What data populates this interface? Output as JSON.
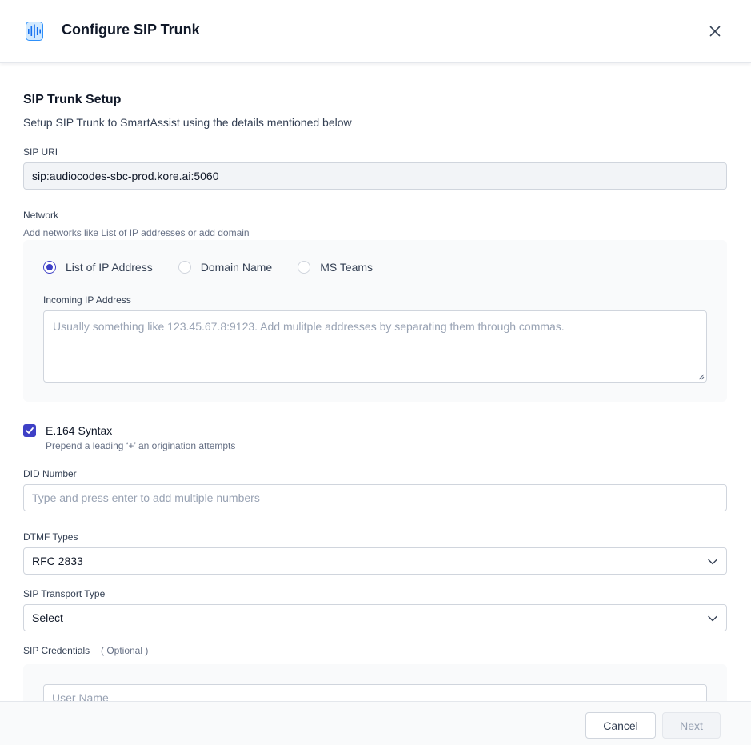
{
  "header": {
    "title": "Configure SIP Trunk",
    "icon": "sound-wave-icon"
  },
  "form": {
    "section_title": "SIP Trunk Setup",
    "section_desc": "Setup SIP Trunk to SmartAssist using the details mentioned below",
    "sip_uri": {
      "label": "SIP URI",
      "value": "sip:audiocodes-sbc-prod.kore.ai:5060"
    },
    "network": {
      "label": "Network",
      "hint": "Add networks like List of IP addresses or add domain",
      "options": [
        "List of IP Address",
        "Domain Name",
        "MS Teams"
      ],
      "selected": "List of IP Address",
      "incoming_label": "Incoming IP Address",
      "incoming_placeholder": "Usually something like 123.45.67.8:9123. Add mulitple addresses by separating them through commas."
    },
    "e164": {
      "label": "E.164 Syntax",
      "hint": "Prepend a leading ‘+’ an origination attempts",
      "checked": true
    },
    "did": {
      "label": "DID Number",
      "placeholder": "Type and press enter to add multiple numbers"
    },
    "dtmf": {
      "label": "DTMF Types",
      "value": "RFC 2833"
    },
    "transport": {
      "label": "SIP Transport Type",
      "value": "Select"
    },
    "credentials": {
      "label": "SIP Credentials",
      "optional": "( Optional )",
      "username_placeholder": "User Name"
    }
  },
  "footer": {
    "cancel": "Cancel",
    "next": "Next"
  },
  "colors": {
    "accent": "#3e40c6",
    "icon_blue": "#2e90fa"
  }
}
